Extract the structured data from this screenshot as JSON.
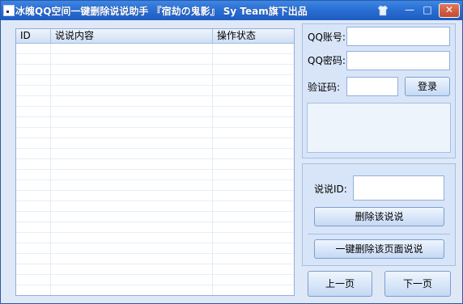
{
  "window": {
    "title": "冰魄QQ空间一键删除说说助手 『宿劫の鬼影』 Sy Team旗下出品",
    "minimize_glyph": "—",
    "maximize_glyph": "□",
    "close_glyph": "✕",
    "skin_icon": "shirt-icon"
  },
  "list": {
    "columns": [
      "ID",
      "说说内容",
      "操作状态"
    ]
  },
  "login": {
    "account_label": "QQ账号:",
    "password_label": "QQ密码:",
    "captcha_label": "验证码:",
    "login_button": "登录"
  },
  "delete": {
    "id_label": "说说ID:",
    "delete_one_button": "删除该说说",
    "delete_page_button": "一键删除该页面说说"
  },
  "nav": {
    "prev_button": "上一页",
    "next_button": "下一页"
  }
}
